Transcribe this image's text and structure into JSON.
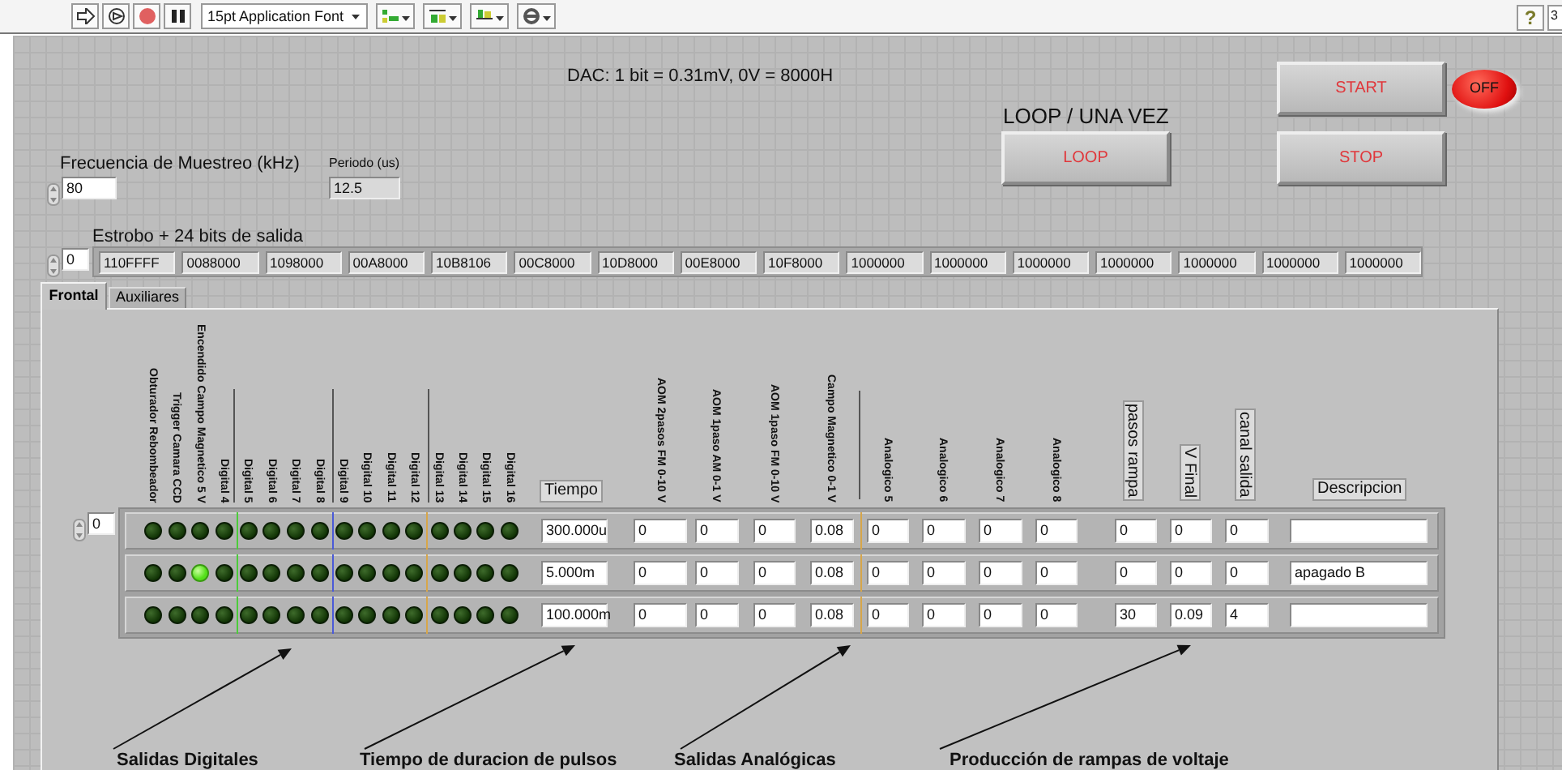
{
  "toolbar": {
    "font_menu": "15pt Application Font",
    "help": "?",
    "page_number": "3"
  },
  "dac_note": "DAC: 1 bit = 0.31mV,  0V = 8000H",
  "start_button": {
    "label": "START"
  },
  "run_led": {
    "label": "OFF",
    "on": false
  },
  "loop_control": {
    "caption": "LOOP / UNA VEZ",
    "label": "LOOP"
  },
  "stop_button": {
    "label": "STOP"
  },
  "frequency": {
    "label": "Frecuencia de Muestreo (kHz)",
    "value": "80"
  },
  "period": {
    "label": "Periodo (us)",
    "value": "12.5"
  },
  "strobe": {
    "label": "Estrobo + 24 bits de salida",
    "index": "0",
    "values": [
      "110FFFF",
      "0088000",
      "1098000",
      "00A8000",
      "10B8106",
      "00C8000",
      "10D8000",
      "00E8000",
      "10F8000",
      "1000000",
      "1000000",
      "1000000",
      "1000000",
      "1000000",
      "1000000",
      "1000000"
    ]
  },
  "tabs": [
    {
      "label": "Frontal",
      "selected": true
    },
    {
      "label": "Auxiliares",
      "selected": false
    }
  ],
  "sequence": {
    "index": "0",
    "digital_headers": [
      "Obturador Rebombeador",
      "Trigger Camara CCD",
      "Encendido Campo Magnetico 5 V",
      "Digital 4",
      "Digital 5",
      "Digital 6",
      "Digital 7",
      "Digital 8",
      "Digital 9",
      "Digital 10",
      "Digital 11",
      "Digital 12",
      "Digital 13",
      "Digital 14",
      "Digital 15",
      "Digital 16"
    ],
    "time_header": "Tiempo",
    "analog_headers": [
      "AOM 2pasos FM 0-10 V",
      "AOM 1paso AM 0-1 V",
      "AOM 1paso FM 0-10 V",
      "Campo Magnetico 0-1 V",
      "Analogico 5",
      "Analogico 6",
      "Analogico 7",
      "Analogico 8"
    ],
    "ramp_headers": [
      "pasos rampa",
      "V Final",
      "canal salida"
    ],
    "description_header": "Descripcion",
    "rows": [
      {
        "digital": [
          {
            "on": false
          },
          {
            "on": false
          },
          {
            "on": false
          },
          {
            "on": false
          },
          {
            "on": false
          },
          {
            "on": false
          },
          {
            "on": false
          },
          {
            "on": false
          },
          {
            "on": false
          },
          {
            "on": false
          },
          {
            "on": false
          },
          {
            "on": false
          },
          {
            "on": false
          },
          {
            "on": false
          },
          {
            "on": false
          },
          {
            "on": false
          }
        ],
        "time": "300.000u",
        "analog": [
          "0",
          "0",
          "0",
          "0.08",
          "0",
          "0",
          "0",
          "0"
        ],
        "ramp": [
          "0",
          "0",
          "0"
        ]
      },
      {
        "digital": [
          {
            "on": false
          },
          {
            "on": false
          },
          {
            "on": true
          },
          {
            "on": false
          },
          {
            "on": false
          },
          {
            "on": false
          },
          {
            "on": false
          },
          {
            "on": false
          },
          {
            "on": false
          },
          {
            "on": false
          },
          {
            "on": false
          },
          {
            "on": false
          },
          {
            "on": false
          },
          {
            "on": false
          },
          {
            "on": false
          },
          {
            "on": false
          }
        ],
        "time": "5.000m",
        "analog": [
          "0",
          "0",
          "0",
          "0.08",
          "0",
          "0",
          "0",
          "0"
        ],
        "ramp": [
          "0",
          "0",
          "0"
        ],
        "description": "apagado B"
      },
      {
        "digital": [
          {
            "on": false
          },
          {
            "on": false
          },
          {
            "on": false
          },
          {
            "on": false
          },
          {
            "on": false
          },
          {
            "on": false
          },
          {
            "on": false
          },
          {
            "on": false
          },
          {
            "on": false
          },
          {
            "on": false
          },
          {
            "on": false
          },
          {
            "on": false
          },
          {
            "on": false
          },
          {
            "on": false
          },
          {
            "on": false
          },
          {
            "on": false
          }
        ],
        "time": "100.000m",
        "analog": [
          "0",
          "0",
          "0",
          "0.08",
          "0",
          "0",
          "0",
          "0"
        ],
        "ramp": [
          "30",
          "0.09",
          "4"
        ]
      }
    ]
  },
  "annotations": [
    {
      "label": "Salidas Digitales"
    },
    {
      "label": "Tiempo de duracion de pulsos"
    },
    {
      "label": "Salidas Analógicas"
    },
    {
      "label": "Producción de rampas de voltaje"
    }
  ]
}
